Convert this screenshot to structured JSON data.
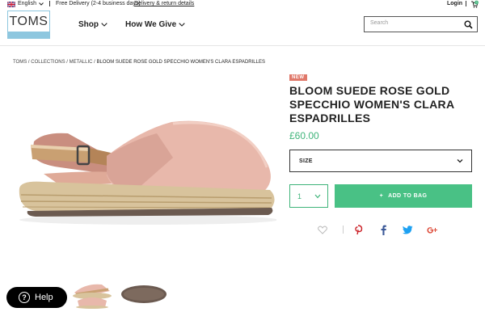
{
  "topbar": {
    "language": "English",
    "delivery": "Free Delivery (2-4 business days)",
    "delivery_link": "Delivery & return details",
    "login": "Login",
    "cart_count": "0"
  },
  "logo": {
    "text": "TOMS"
  },
  "nav": {
    "items": [
      {
        "label": "Shop"
      },
      {
        "label": "How We Give"
      }
    ]
  },
  "search": {
    "placeholder": "Search"
  },
  "breadcrumb": {
    "links": [
      "TOMS",
      "COLLECTIONS",
      "METALLIC"
    ],
    "current": "BLOOM SUEDE ROSE GOLD SPECCHIO WOMEN'S CLARA ESPADRILLES",
    "separator": " / "
  },
  "product": {
    "badge": "NEW",
    "title": "BLOOM SUEDE ROSE GOLD SPECCHIO WOMEN'S CLARA ESPADRILLES",
    "price": "£60.00",
    "size_label": "SIZE",
    "quantity": "1",
    "add_to_bag": "ADD TO BAG",
    "add_icon": "+"
  },
  "share": {
    "icons": [
      "heart-icon",
      "pinterest-icon",
      "facebook-icon",
      "twitter-icon",
      "google-plus-icon"
    ]
  },
  "help": {
    "label": "Help",
    "icon": "?"
  },
  "colors": {
    "accent_green": "#49c185",
    "price_green": "#3fb47a",
    "badge": "#e0786a",
    "logo_blue": "#8ec7df"
  }
}
